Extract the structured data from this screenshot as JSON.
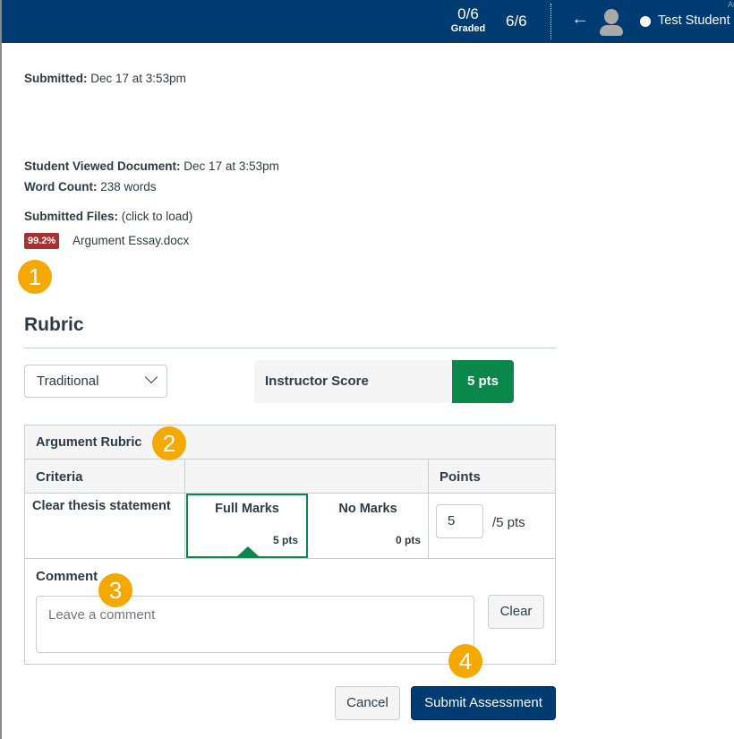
{
  "header": {
    "graded_count": "0/6",
    "graded_label": "Graded",
    "student_count": "6/6",
    "student_name": "Test Student",
    "corner_text": "Au"
  },
  "submission": {
    "submitted_label": "Submitted:",
    "submitted_value": "Dec 17 at 3:53pm",
    "viewed_label": "Student Viewed Document:",
    "viewed_value": "Dec 17 at 3:53pm",
    "word_label": "Word Count:",
    "word_value": "238 words",
    "files_label": "Submitted Files:",
    "files_hint": "(click to load)",
    "score_badge": "99.2%",
    "file_name": "Argument Essay.docx",
    "badge_color": "#a83232"
  },
  "markers": [
    "1",
    "2",
    "3",
    "4"
  ],
  "rubric": {
    "heading": "Rubric",
    "view_select": "Traditional",
    "instructor_label": "Instructor Score",
    "instructor_score": "5 pts",
    "score_color": "#0b874b",
    "title": "Argument Rubric",
    "col_criteria": "Criteria",
    "col_points": "Points",
    "criterion": "Clear thesis statement",
    "ratings": [
      {
        "label": "Full Marks",
        "pts": "5 pts",
        "selected": true
      },
      {
        "label": "No Marks",
        "pts": "0 pts",
        "selected": false
      }
    ],
    "points_value": "5",
    "points_max": "/5 pts",
    "comment_label": "Comment",
    "comment_placeholder": "Leave a comment",
    "clear": "Clear"
  },
  "actions": {
    "cancel": "Cancel",
    "submit": "Submit Assessment"
  }
}
